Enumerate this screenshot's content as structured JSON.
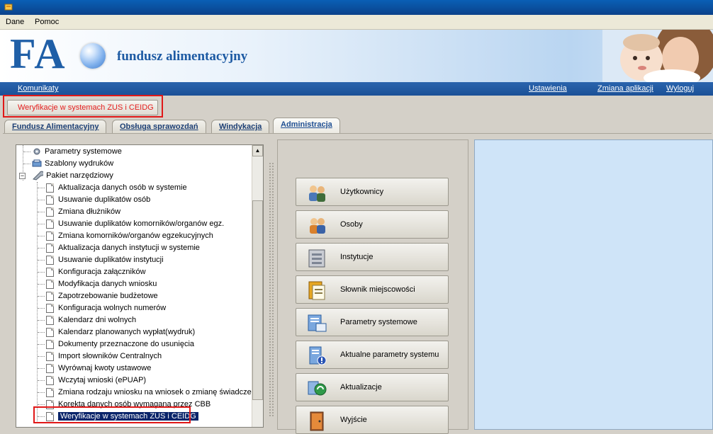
{
  "menu": {
    "dane": "Dane",
    "pomoc": "Pomoc"
  },
  "banner": {
    "logo": "FA",
    "app_name": "fundusz alimentacyjny"
  },
  "nav": {
    "komunikaty": "Komunikaty",
    "ustawienia": "Ustawienia",
    "zmiana": "Zmiana aplikacji",
    "wyloguj": "Wyloguj"
  },
  "toolbar": {
    "verify_label": "Weryfikacje w systemach ZUS i CEIDG"
  },
  "tabs": [
    {
      "label": "Fundusz Alimentacyjny"
    },
    {
      "label": "Obsługa sprawozdań"
    },
    {
      "label": "Windykacja"
    },
    {
      "label": "Administracja"
    }
  ],
  "tree": {
    "root_items": [
      "Parametry systemowe",
      "Szablony wydruków",
      "Pakiet narzędziowy"
    ],
    "children": [
      "Aktualizacja danych osób w systemie",
      "Usuwanie duplikatów osób",
      "Zmiana dłużników",
      "Usuwanie duplikatów komorników/organów egz.",
      "Zmiana komorników/organów egzekucyjnych",
      "Aktualizacja danych instytucji w systemie",
      "Usuwanie duplikatów instytucji",
      "Konfiguracja załączników",
      "Modyfikacja danych wniosku",
      "Zapotrzebowanie budżetowe",
      "Konfiguracja wolnych numerów",
      "Kalendarz dni wolnych",
      "Kalendarz planowanych wypłat(wydruk)",
      "Dokumenty przeznaczone do usunięcia",
      "Import słowników Centralnych",
      "Wyrównaj kwoty ustawowe",
      "Wczytaj wnioski (ePUAP)",
      "Zmiana rodzaju wniosku na wniosek o zmianę świadczenia",
      "Korekta danych osób wymagana przez CBB",
      "Weryfikacje w systemach ZUS i CEIDG"
    ]
  },
  "buttons": [
    {
      "label": "Użytkownicy",
      "icon": "users-icon"
    },
    {
      "label": "Osoby",
      "icon": "persons-icon"
    },
    {
      "label": "Instytucje",
      "icon": "institutions-icon"
    },
    {
      "label": "Słownik miejscowości",
      "icon": "dictionary-icon"
    },
    {
      "label": "Parametry systemowe",
      "icon": "system-parameters-icon"
    },
    {
      "label": "Aktualne parametry systemu",
      "icon": "current-parameters-icon"
    },
    {
      "label": "Aktualizacje",
      "icon": "updates-icon"
    },
    {
      "label": "Wyjście",
      "icon": "exit-door-icon"
    }
  ],
  "colors": {
    "accent": "#1f5fa7",
    "highlight_red": "#e01818",
    "selection": "#0a246a"
  }
}
